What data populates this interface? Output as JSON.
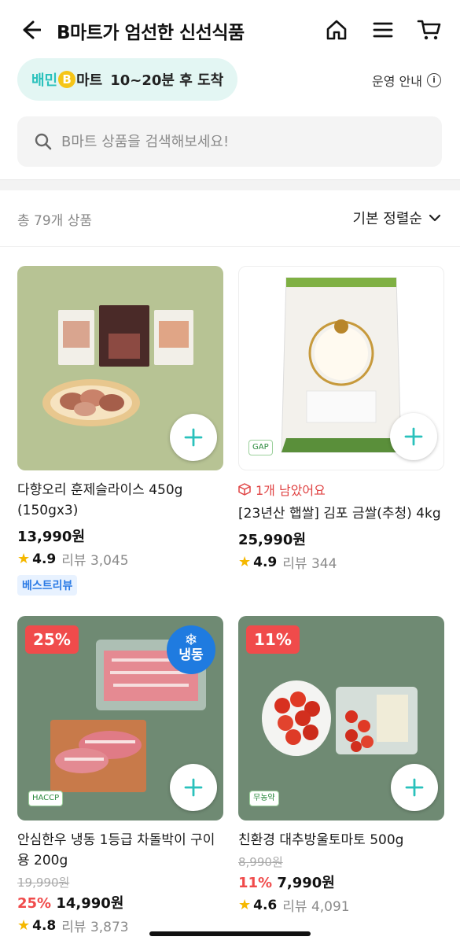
{
  "header": {
    "title": "B마트가 엄선한 신선식품"
  },
  "delivery": {
    "logo_prefix": "배민",
    "logo_b": "B",
    "logo_suffix": "마트",
    "eta": "10~20분 후 도착"
  },
  "ops": {
    "label": "운영 안내",
    "info_glyph": "i"
  },
  "search": {
    "placeholder": "B마트 상품을 검색해보세요!"
  },
  "listing": {
    "count_label": "총 79개 상품",
    "sort_label": "기본 정렬순"
  },
  "products": [
    {
      "name": "다향오리 훈제슬라이스 450g (150gx3)",
      "price": "13,990원",
      "rating": "4.9",
      "review_label": "리뷰 3,045",
      "badge": "베스트리뷰"
    },
    {
      "stock": "1개 남았어요",
      "name": "[23년산 햅쌀] 김포 금쌀(추청) 4kg",
      "price": "25,990원",
      "rating": "4.9",
      "review_label": "리뷰 344",
      "cert": "GAP"
    },
    {
      "discount_tag": "25%",
      "frozen_label": "냉동",
      "frozen_icon": "❄",
      "cert": "HACCP",
      "name": "안심한우 냉동 1등급 차돌박이 구이용 200g",
      "original_price": "19,990원",
      "discount": "25%",
      "price": "14,990원",
      "rating": "4.8",
      "review_label": "리뷰 3,873"
    },
    {
      "discount_tag": "11%",
      "cert": "무농약",
      "name": "친환경 대추방울토마토 500g",
      "original_price": "8,990원",
      "discount": "11%",
      "price": "7,990원",
      "rating": "4.6",
      "review_label": "리뷰 4,091"
    }
  ],
  "colors": {
    "accent": "#2ac1bc",
    "discount_red": "#f04b4b",
    "star": "#f5b800",
    "frozen_blue": "#1f7be0"
  }
}
